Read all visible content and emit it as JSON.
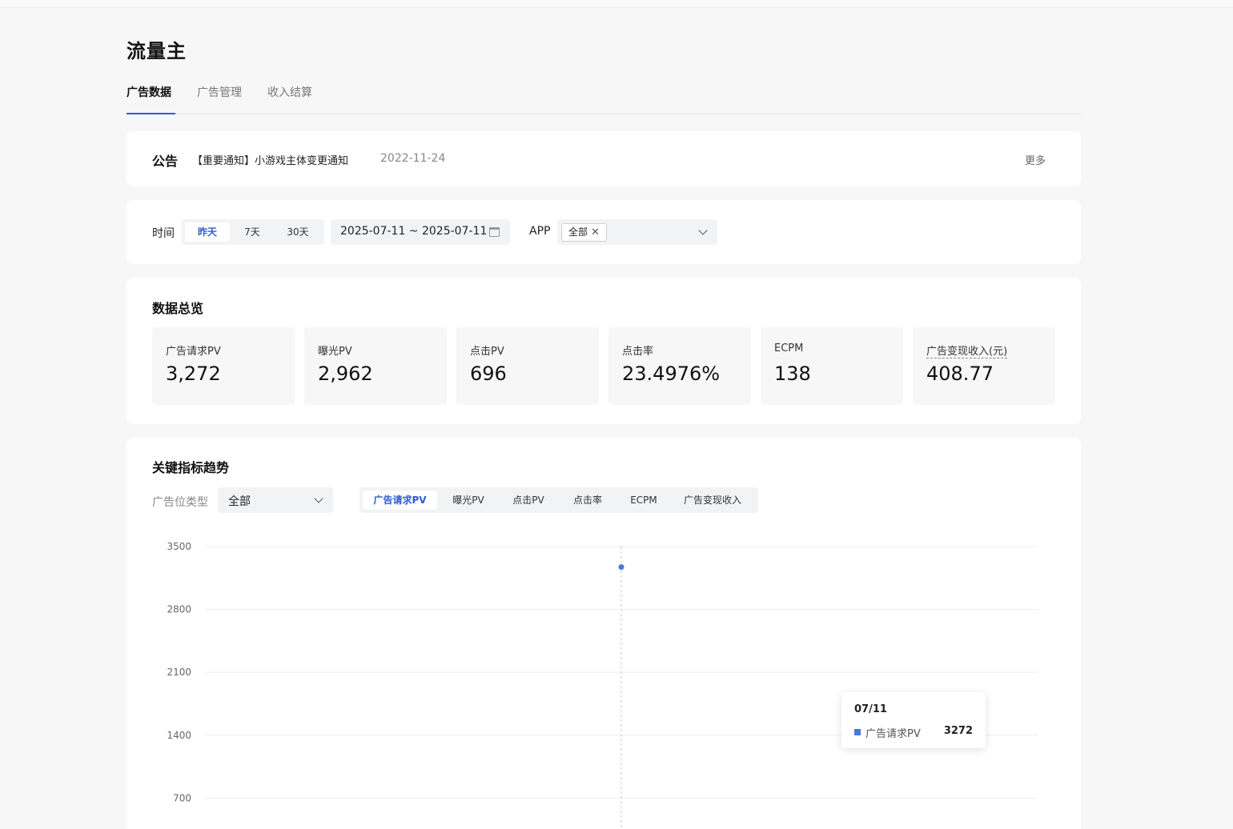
{
  "page": {
    "title": "流量主"
  },
  "tabs": [
    {
      "label": "广告数据",
      "active": true
    },
    {
      "label": "广告管理",
      "active": false
    },
    {
      "label": "收入结算",
      "active": false
    }
  ],
  "notice": {
    "label": "公告",
    "text": "【重要通知】小游戏主体变更通知",
    "date": "2022-11-24",
    "more": "更多"
  },
  "filter": {
    "time_label": "时间",
    "range_options": [
      {
        "label": "昨天",
        "active": true
      },
      {
        "label": "7天",
        "active": false
      },
      {
        "label": "30天",
        "active": false
      }
    ],
    "date_range": "2025-07-11 ~ 2025-07-11",
    "app_label": "APP",
    "app_selected": "全部",
    "app_remove_glyph": "✕"
  },
  "overview": {
    "title": "数据总览",
    "stats": [
      {
        "name": "广告请求PV",
        "value": "3,272"
      },
      {
        "name": "曝光PV",
        "value": "2,962"
      },
      {
        "name": "点击PV",
        "value": "696"
      },
      {
        "name": "点击率",
        "value": "23.4976%"
      },
      {
        "name": "ECPM",
        "value": "138"
      },
      {
        "name": "广告变现收入(元)",
        "value": "408.77"
      }
    ]
  },
  "trend": {
    "title": "关键指标趋势",
    "type_label": "广告位类型",
    "type_selected": "全部",
    "metrics": [
      {
        "label": "广告请求PV",
        "active": true
      },
      {
        "label": "曝光PV",
        "active": false
      },
      {
        "label": "点击PV",
        "active": false
      },
      {
        "label": "点击率",
        "active": false
      },
      {
        "label": "ECPM",
        "active": false
      },
      {
        "label": "广告变现收入",
        "active": false
      }
    ],
    "series_color": "#4a78d8",
    "tooltip": {
      "date": "07/11",
      "series": "广告请求PV",
      "value": "3272"
    }
  },
  "chart_data": {
    "type": "line",
    "x": [
      "07/11"
    ],
    "series": [
      {
        "name": "广告请求PV",
        "values": [
          3272
        ]
      }
    ],
    "yticks": [
      3500,
      2800,
      2100,
      1400,
      700
    ],
    "ylim": [
      0,
      3500
    ],
    "grid": true
  }
}
